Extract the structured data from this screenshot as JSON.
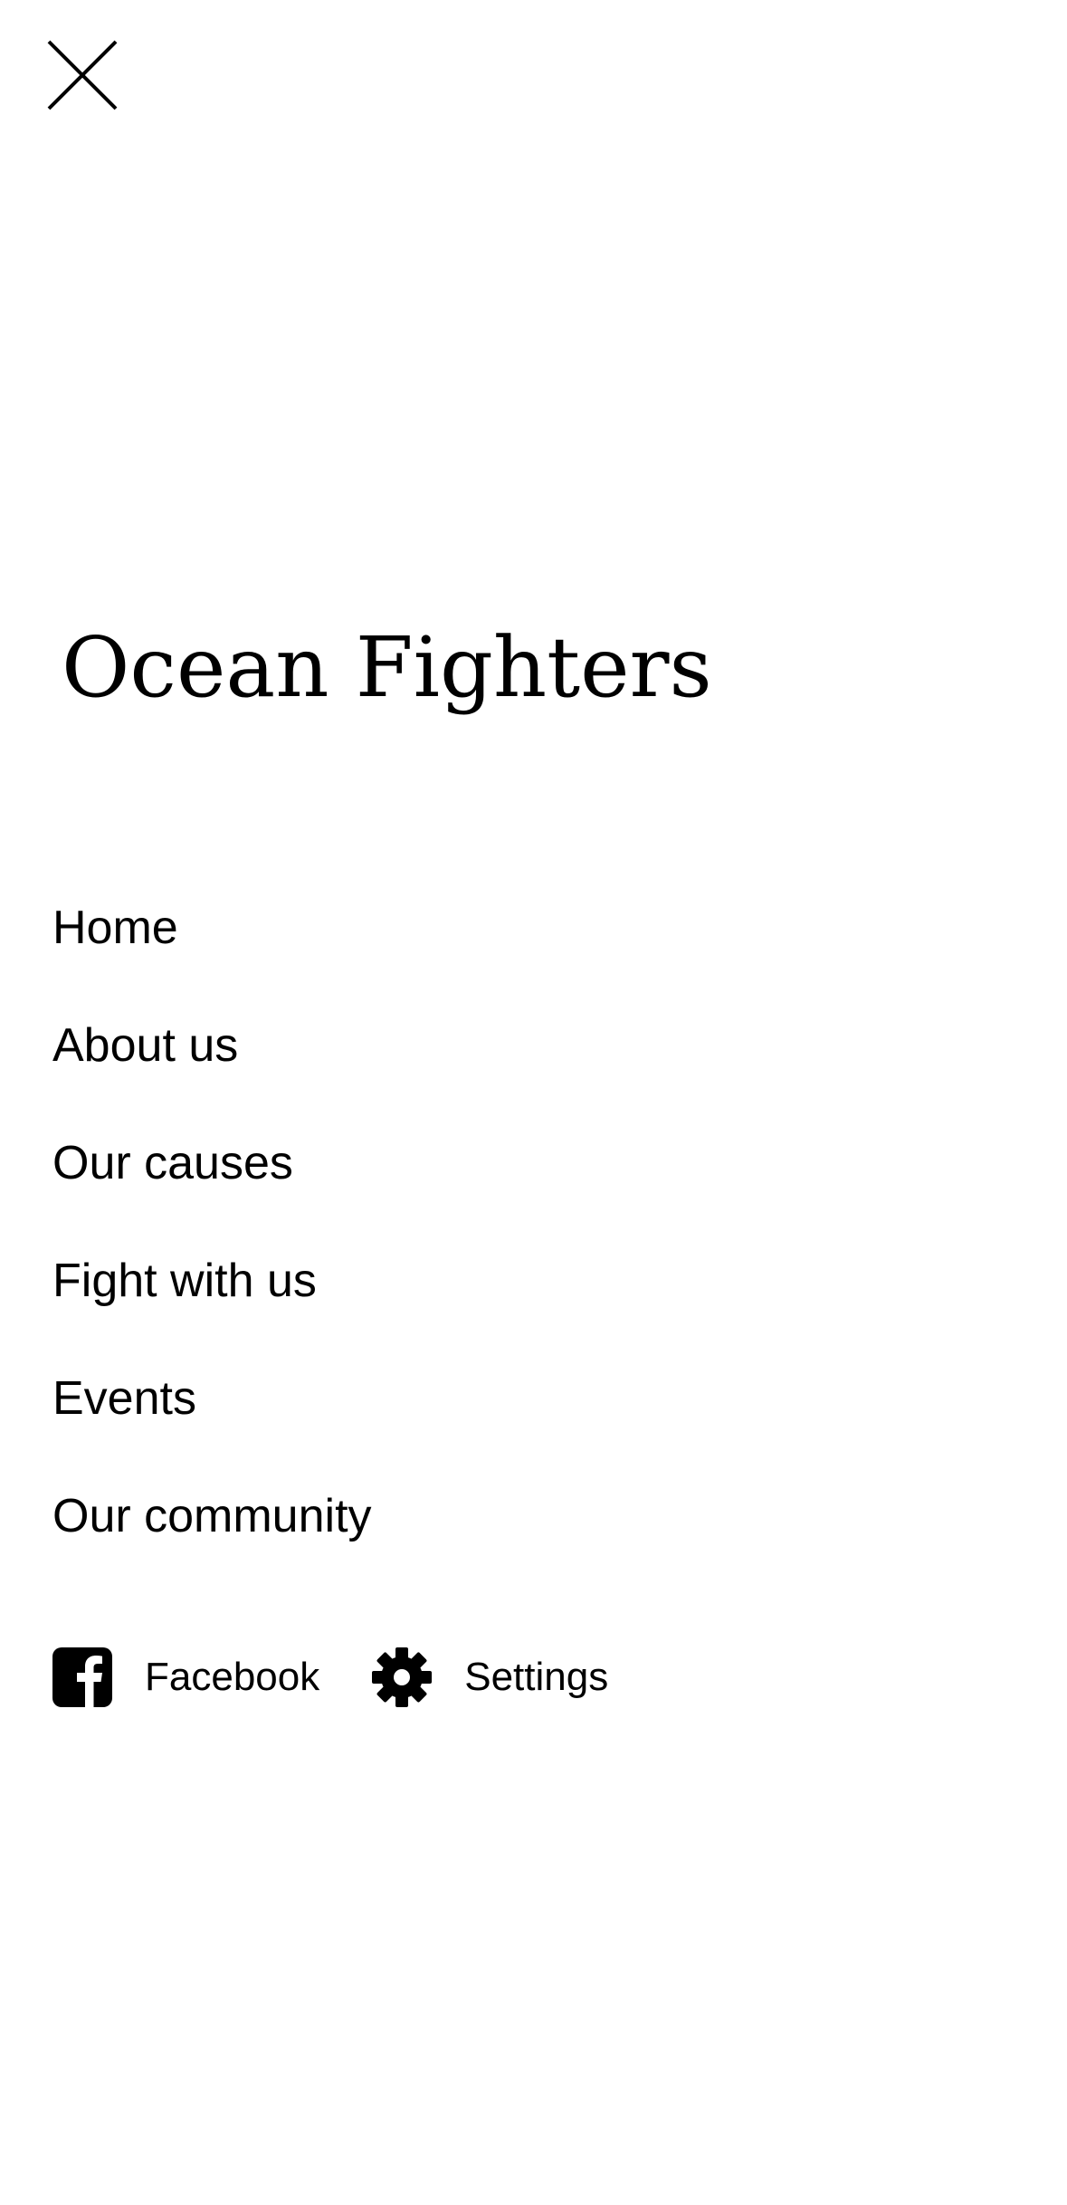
{
  "close": {
    "icon": "close-icon"
  },
  "brand": {
    "title": "Ocean Fighters"
  },
  "nav": {
    "items": [
      {
        "label": "Home"
      },
      {
        "label": "About us"
      },
      {
        "label": "Our causes"
      },
      {
        "label": "Fight with us"
      },
      {
        "label": "Events"
      },
      {
        "label": "Our community"
      }
    ]
  },
  "footer": {
    "facebook": {
      "label": "Facebook",
      "icon": "facebook-icon"
    },
    "settings": {
      "label": "Settings",
      "icon": "gear-icon"
    }
  },
  "colors": {
    "background": "#ffffff",
    "text": "#000000"
  }
}
